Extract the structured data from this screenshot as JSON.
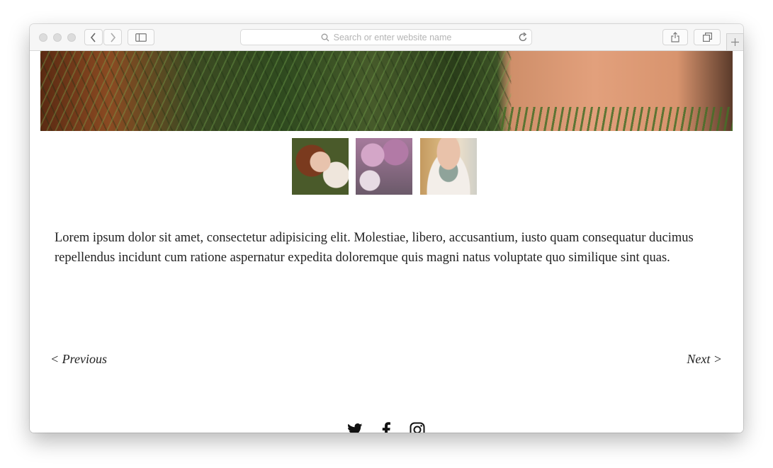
{
  "browser": {
    "address_placeholder": "Search or enter website name",
    "icons": [
      "back-icon",
      "forward-icon",
      "sidebar-icon",
      "search-icon",
      "reload-icon",
      "share-icon",
      "tabs-icon",
      "plus-icon"
    ]
  },
  "gallery": {
    "hero_image": "woman lying in grass",
    "thumbnails": [
      "bride lying in grass",
      "bride with cherry blossom tree",
      "bride with pearl necklace"
    ]
  },
  "article": {
    "body": "Lorem ipsum dolor sit amet, consectetur adipisicing elit. Molestiae, libero, accusantium, iusto quam consequatur ducimus repellendus incidunt cum ratione aspernatur expedita doloremque quis magni natus voluptate quo similique sint quas."
  },
  "pagination": {
    "previous_label": "< Previous",
    "next_label": "Next >"
  },
  "social": {
    "icons": [
      "twitter-icon",
      "facebook-icon",
      "instagram-icon"
    ]
  }
}
